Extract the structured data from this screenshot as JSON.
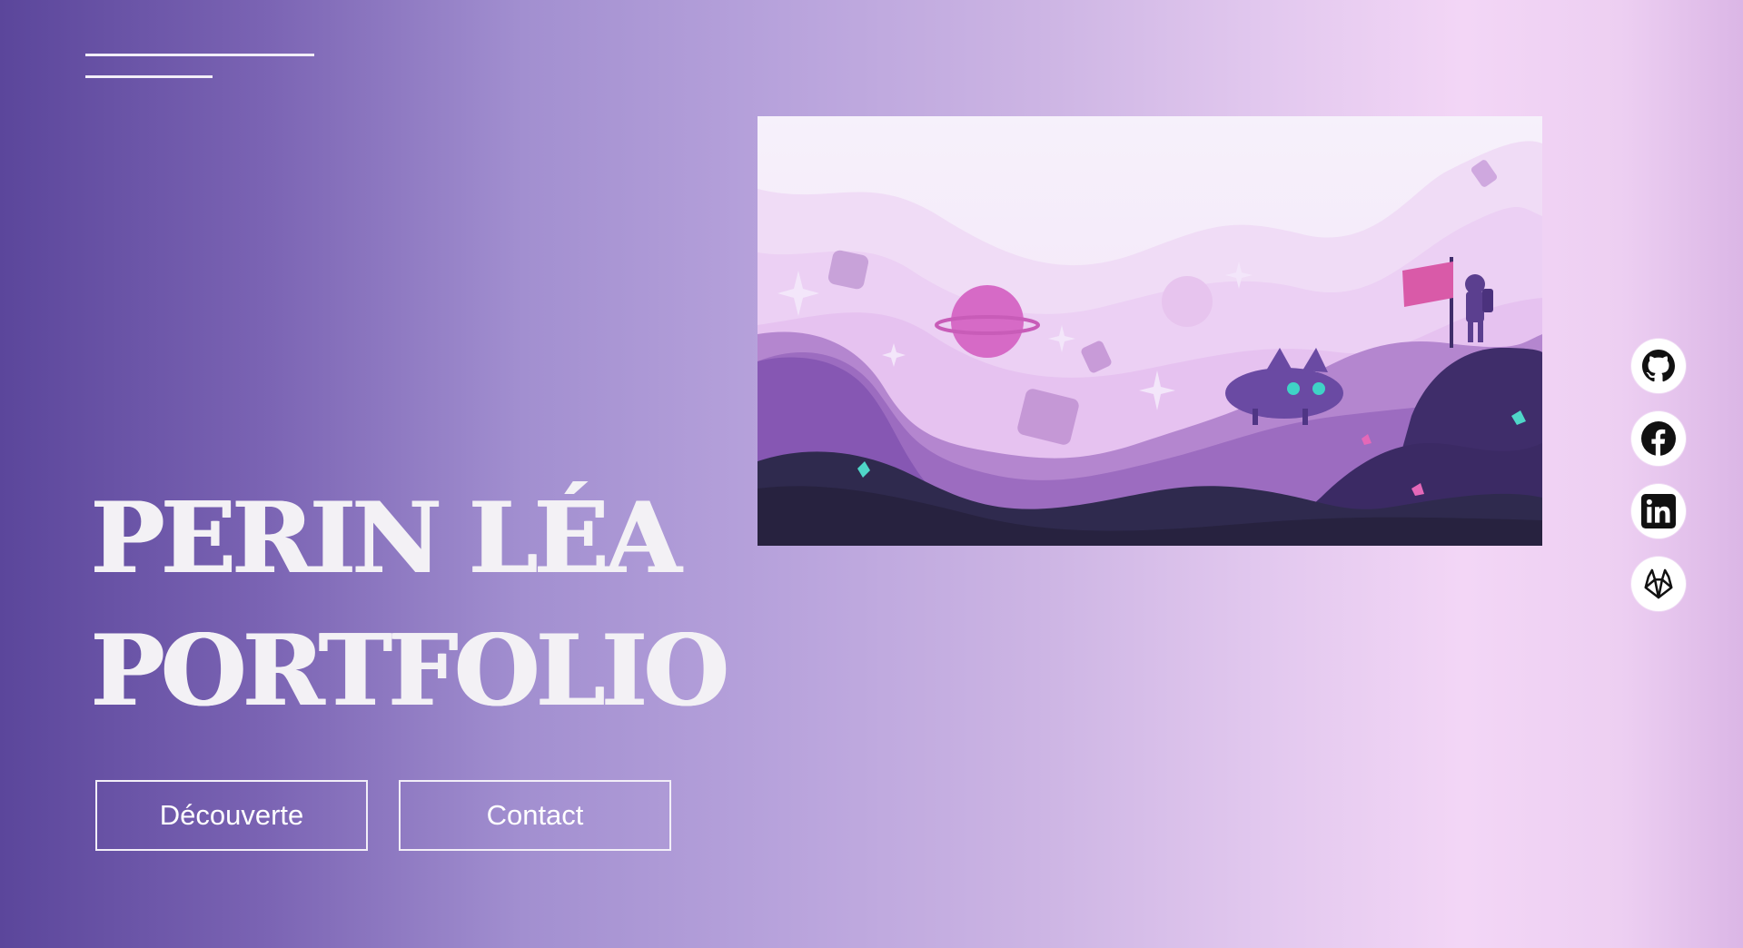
{
  "hero": {
    "line1": "PERIN LÉA",
    "line2": "PORTFOLIO"
  },
  "buttons": {
    "discover_label": "Découverte",
    "contact_label": "Contact"
  },
  "socials": [
    {
      "icon": "github-icon"
    },
    {
      "icon": "facebook-icon"
    },
    {
      "icon": "linkedin-icon"
    },
    {
      "icon": "gitlab-icon"
    }
  ],
  "colors": {
    "gradient_start": "#5b469b",
    "gradient_mid": "#b8a3dc",
    "gradient_light": "#f3d6f6",
    "text_light": "#f3f1f5"
  }
}
